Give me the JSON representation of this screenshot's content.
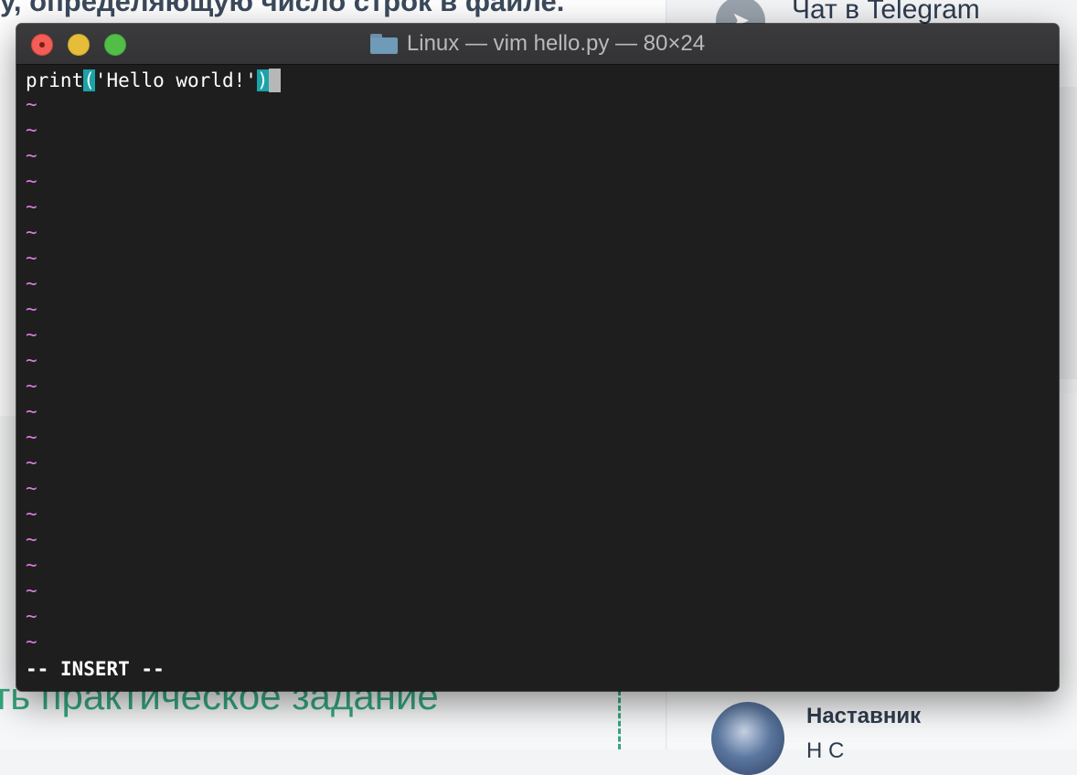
{
  "background": {
    "title_fragment": "у, определяющую число строк в файле.",
    "telegram_label": "Чат в Telegram",
    "practice_fragment": "ть практическое задание",
    "mentor_label": "Наставник",
    "mentor_name_fragment": "Н        С"
  },
  "window": {
    "title": "Linux — vim hello.py — 80×24",
    "folder_icon": "folder-icon"
  },
  "editor": {
    "code_prefix": "print",
    "paren_open": "(",
    "string_literal": "'Hello world!'",
    "paren_close": ")",
    "tilde": "~",
    "mode_line": "-- INSERT --"
  },
  "colors": {
    "terminal_bg": "#1e1e1e",
    "tilde": "#d77dde",
    "paren_highlight": "#1aa3a8",
    "cursor": "#b7b7b7"
  }
}
